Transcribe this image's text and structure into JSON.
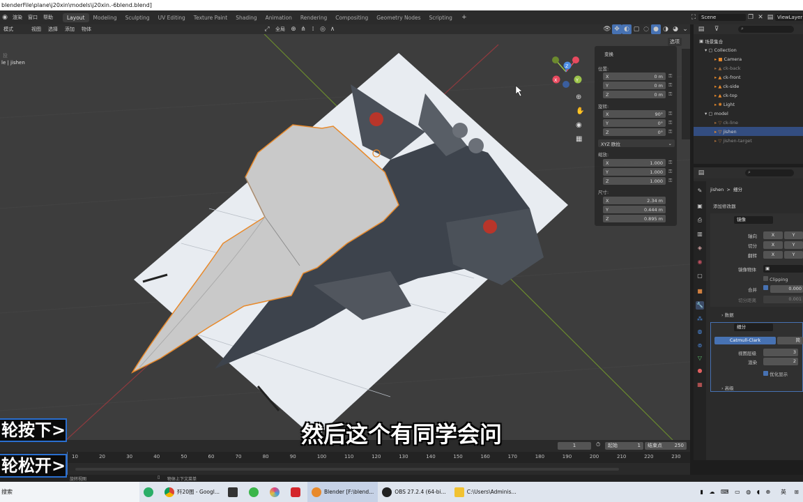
{
  "window": {
    "title": "blenderFile\\plane\\j20xin\\models\\j20xin.-6blend.blend]"
  },
  "menu": {
    "items": [
      "渲染",
      "窗口",
      "帮助"
    ]
  },
  "workspaces": [
    {
      "label": "Layout",
      "active": true
    },
    {
      "label": "Modeling"
    },
    {
      "label": "Sculpting"
    },
    {
      "label": "UV Editing"
    },
    {
      "label": "Texture Paint"
    },
    {
      "label": "Shading"
    },
    {
      "label": "Animation"
    },
    {
      "label": "Rendering"
    },
    {
      "label": "Compositing"
    },
    {
      "label": "Geometry Nodes"
    },
    {
      "label": "Scripting"
    }
  ],
  "scene": {
    "scene_label": "Scene",
    "viewlayer_label": "ViewLayer"
  },
  "viewport_header": {
    "mode": "模式",
    "menus": [
      "视图",
      "选择",
      "添加",
      "物体"
    ],
    "orientation": "全局",
    "options_label": "选项"
  },
  "viewport": {
    "overlay_text1": "投",
    "overlay_text2": "le | jishen",
    "gizmo": {
      "x": "X",
      "y": "Y",
      "z": "Z"
    }
  },
  "npanel": {
    "section": "变换",
    "location_label": "位置:",
    "location": [
      {
        "axis": "X",
        "value": "0 m"
      },
      {
        "axis": "Y",
        "value": "0 m"
      },
      {
        "axis": "Z",
        "value": "0 m"
      }
    ],
    "rotation_label": "旋转:",
    "rotation": [
      {
        "axis": "X",
        "value": "90°"
      },
      {
        "axis": "Y",
        "value": "0°"
      },
      {
        "axis": "Z",
        "value": "0°"
      }
    ],
    "rotation_mode": "XYZ 欧拉",
    "scale_label": "缩放:",
    "scale": [
      {
        "axis": "X",
        "value": "1.000"
      },
      {
        "axis": "Y",
        "value": "1.000"
      },
      {
        "axis": "Z",
        "value": "1.000"
      }
    ],
    "dimensions_label": "尺寸:",
    "dimensions": [
      {
        "axis": "X",
        "value": "2.34 m"
      },
      {
        "axis": "Y",
        "value": "0.444 m"
      },
      {
        "axis": "Z",
        "value": "0.895 m"
      }
    ]
  },
  "outliner": {
    "root": "场景集合",
    "rows": [
      {
        "label": "Collection",
        "indent": 1
      },
      {
        "label": "Camera",
        "indent": 2
      },
      {
        "label": "ck-back",
        "indent": 2,
        "dim": true
      },
      {
        "label": "ck-front",
        "indent": 2
      },
      {
        "label": "ck-side",
        "indent": 2
      },
      {
        "label": "ck-top",
        "indent": 2
      },
      {
        "label": "Light",
        "indent": 2
      },
      {
        "label": "model",
        "indent": 1
      },
      {
        "label": "ck-line",
        "indent": 2,
        "dim": true
      },
      {
        "label": "jishen",
        "indent": 2,
        "selected": true
      },
      {
        "label": "jishen-target",
        "indent": 2,
        "dim": true
      }
    ]
  },
  "properties": {
    "object_name": "jishen",
    "modifier_name": "细分",
    "add_modifier": "添加修改器",
    "mirror": {
      "name": "镜像",
      "axis_label": "轴向",
      "bisect_label": "切分",
      "flip_label": "翻转",
      "mirror_object_label": "镜像物体",
      "clipping_label": "Clipping",
      "merge_label": "合并",
      "merge_value": "0.000",
      "bisect_distance_label": "切分距离",
      "bisect_distance_value": "0.001",
      "data_label": "数据",
      "x": "X",
      "y": "Y"
    },
    "subsurf": {
      "name": "细分",
      "catmull": "Catmull-Clark",
      "simple": "简",
      "viewport_levels_label": "视图层级",
      "viewport_levels": "3",
      "render_label": "渲染",
      "render_levels": "2",
      "optimal_label": "优化显示",
      "advanced_label": "高级"
    }
  },
  "timeline": {
    "current_frame": "1",
    "start_label": "起始",
    "start": "1",
    "end_label": "结束点",
    "end": "250",
    "ticks": [
      "10",
      "20",
      "30",
      "40",
      "50",
      "60",
      "70",
      "80",
      "90",
      "100",
      "110",
      "120",
      "130",
      "140",
      "150",
      "160",
      "170",
      "180",
      "190",
      "200",
      "210",
      "220",
      "230"
    ]
  },
  "statusbar": {
    "left": "旋转视图",
    "middle": "物体上下文菜单"
  },
  "overlays": {
    "badge1": "轮按下>",
    "badge2": "轮松开>",
    "subtitle": "然后这个有同学会问"
  },
  "taskbar": {
    "search": "搜索",
    "items": [
      {
        "label": "歼20图 - Googl..."
      },
      {
        "label": "Blender [F:\\blend...",
        "active": true
      },
      {
        "label": "OBS 27.2.4 (64-bi..."
      },
      {
        "label": "C:\\Users\\Adminis..."
      }
    ],
    "lang": "英"
  },
  "colors": {
    "accent": "#4772b3",
    "selected_row": "#334d80",
    "outline": "#e8892a",
    "badge_border": "#2a6fd0"
  }
}
